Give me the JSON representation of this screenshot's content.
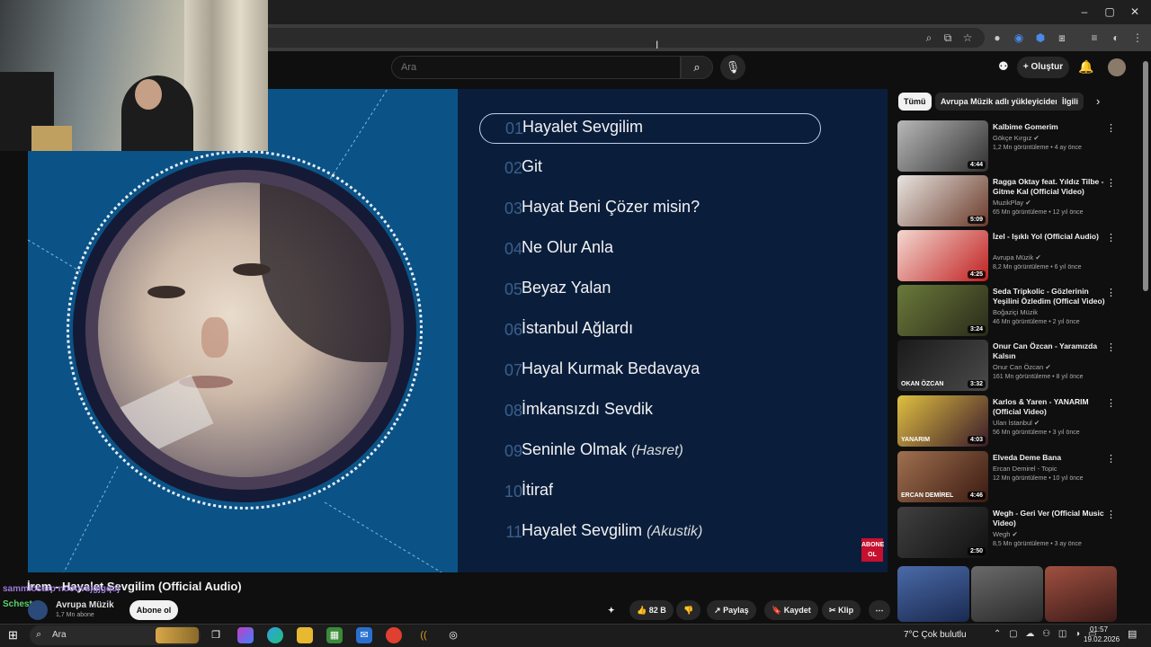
{
  "browser": {
    "window_controls": [
      "–",
      "▢",
      "✕"
    ],
    "toolbar_icons": [
      "zoom-icon",
      "cast-screen-icon",
      "bookmark-star-icon",
      "extension-icon",
      "extension-icon",
      "extension-icon",
      "extensions-puzzle-icon",
      "reading-list-icon",
      "profile-icon",
      "menu-icon"
    ]
  },
  "youtube": {
    "search_placeholder": "Ara",
    "create_label": "Oluştur"
  },
  "video": {
    "title": "İrem - Hayalet Sevgilim (Official Audio)",
    "label_logo": "ABONE OL",
    "tracks": [
      {
        "num": "01",
        "title": "Hayalet Sevgilim",
        "sub": ""
      },
      {
        "num": "02",
        "title": "Git",
        "sub": ""
      },
      {
        "num": "03",
        "title": "Hayat Beni Çözer misin?",
        "sub": ""
      },
      {
        "num": "04",
        "title": "Ne Olur Anla",
        "sub": ""
      },
      {
        "num": "05",
        "title": "Beyaz Yalan",
        "sub": ""
      },
      {
        "num": "06",
        "title": "İstanbul Ağlardı",
        "sub": ""
      },
      {
        "num": "07",
        "title": "Hayal Kurmak Bedavaya",
        "sub": ""
      },
      {
        "num": "08",
        "title": "İmkansızdı Sevdik",
        "sub": ""
      },
      {
        "num": "09",
        "title": "Seninle Olmak",
        "sub": "(Hasret)"
      },
      {
        "num": "10",
        "title": "İtiraf",
        "sub": ""
      },
      {
        "num": "11",
        "title": "Hayalet Sevgilim",
        "sub": "(Akustik)"
      }
    ]
  },
  "channel": {
    "name": "Avrupa Müzik",
    "subs": "1,7 Mn abone",
    "subscribe_label": "Abone ol"
  },
  "chat": {
    "line1": "sammlosarp nooovsjgjgqoj",
    "line2": "Schester"
  },
  "actions": {
    "like": "82 B",
    "share": "Paylaş",
    "save": "Kaydet",
    "clip": "Klip",
    "more": "⋯"
  },
  "chips": [
    "Tümü",
    "Avrupa Müzik adlı yükleyiciden",
    "İlgili"
  ],
  "recommendations": [
    {
      "title": "Kalbime Gomerim",
      "channel": "Gökçe Kırgız ✔",
      "meta": "1,2 Mn görüntüleme • 4 ay önce",
      "duration": "4:44",
      "c1": "#b8b8b8",
      "c2": "#303030"
    },
    {
      "title": "Ragga Oktay feat. Yıldız Tilbe - Gitme Kal (Official Video)",
      "channel": "MuzikPlay ✔",
      "meta": "65 Mn görüntüleme • 12 yıl önce",
      "duration": "5:09",
      "c1": "#e8e4e0",
      "c2": "#6a3a2a"
    },
    {
      "title": "İzel - Işıklı Yol (Official Audio)",
      "channel": "Avrupa Müzik ✔",
      "meta": "8,2 Mn görüntüleme • 6 yıl önce",
      "duration": "4:25",
      "c1": "#f4d8d0",
      "c2": "#c02020"
    },
    {
      "title": "Seda Tripkolic - Gözlerinin Yeşilini Özledim (Offical Video)",
      "channel": "Boğaziçi Müzik",
      "meta": "46 Mn görüntüleme • 2 yıl önce",
      "duration": "3:24",
      "c1": "#6a7a3a",
      "c2": "#2a2a1a"
    },
    {
      "title": "Onur Can Özcan - Yaramızda Kalsın",
      "channel": "Onur Can Özcan ✔",
      "meta": "161 Mn görüntüleme • 8 yıl önce",
      "duration": "3:32",
      "c1": "#1a1a1a",
      "c2": "#4a4a4a"
    },
    {
      "title": "Karlos & Yaren - YANARIM (Official Video)",
      "channel": "Ulan İstanbul ✔",
      "meta": "56 Mn görüntüleme • 3 yıl önce",
      "duration": "4:03",
      "c1": "#e0c040",
      "c2": "#3a1a2a"
    },
    {
      "title": "Elveda Deme Bana",
      "channel": "Ercan Demirel - Topic",
      "meta": "12 Mn görüntüleme • 10 yıl önce",
      "duration": "4:46",
      "c1": "#a07050",
      "c2": "#3a1a10"
    },
    {
      "title": "Wegh - Geri Ver (Official Music Video)",
      "channel": "Wegh ✔",
      "meta": "8,5 Mn görüntüleme • 3 ay önce",
      "duration": "2:50",
      "c1": "#404040",
      "c2": "#101010"
    }
  ],
  "thumb_badges": [
    "OKAN ÖZCAN",
    "YANARIM",
    "ERCAN DEMİREL"
  ],
  "taskbar": {
    "search_label": "Ara",
    "weather": "7°C  Çok bulutlu",
    "time": "01:57",
    "date": "19.02.2026"
  }
}
